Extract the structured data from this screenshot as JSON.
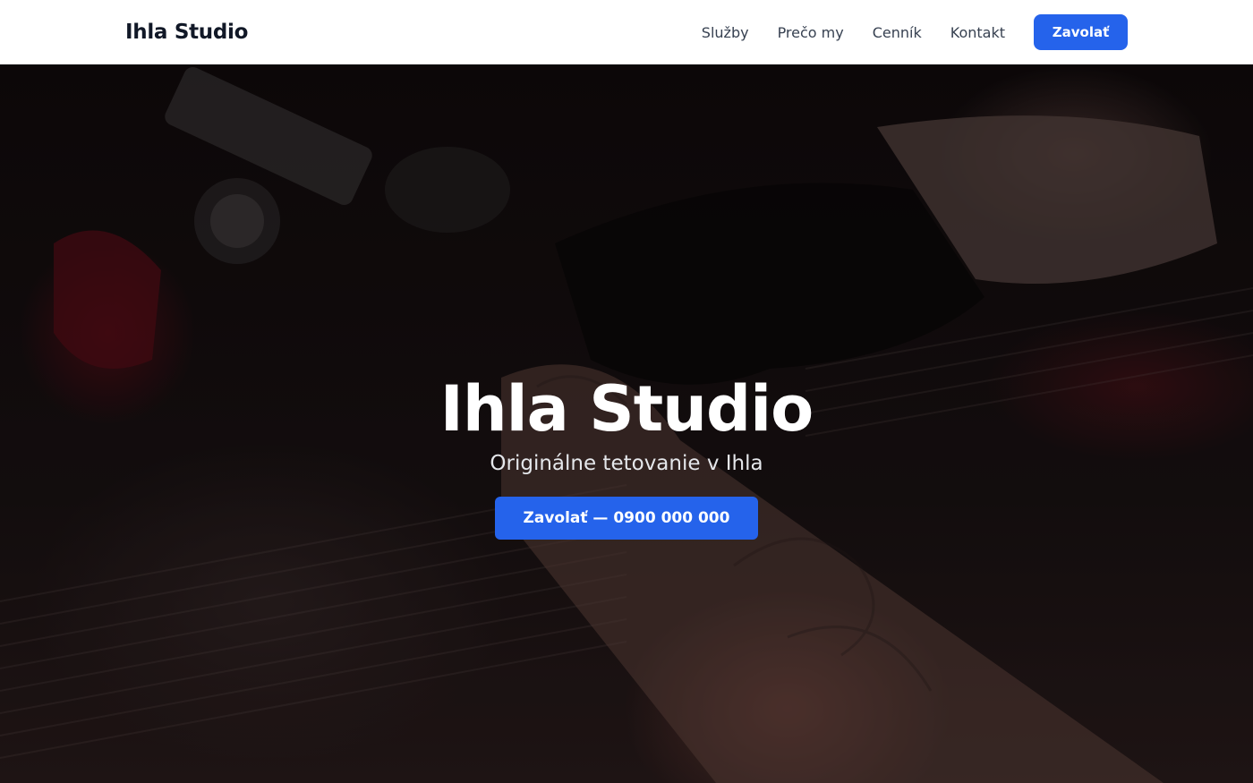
{
  "header": {
    "brand": "Ihla Studio",
    "nav": [
      {
        "label": "Služby"
      },
      {
        "label": "Prečo my"
      },
      {
        "label": "Cenník"
      },
      {
        "label": "Kontakt"
      }
    ],
    "cta_label": "Zavolať"
  },
  "hero": {
    "title": "Ihla Studio",
    "subtitle": "Originálne tetovanie v Ihla",
    "cta_label": "Zavolať — 0900 000 000",
    "background_image": "tattoo-artist-photo"
  },
  "colors": {
    "accent": "#2563eb",
    "nav_bg": "#ffffff",
    "brand_text": "#111827"
  }
}
